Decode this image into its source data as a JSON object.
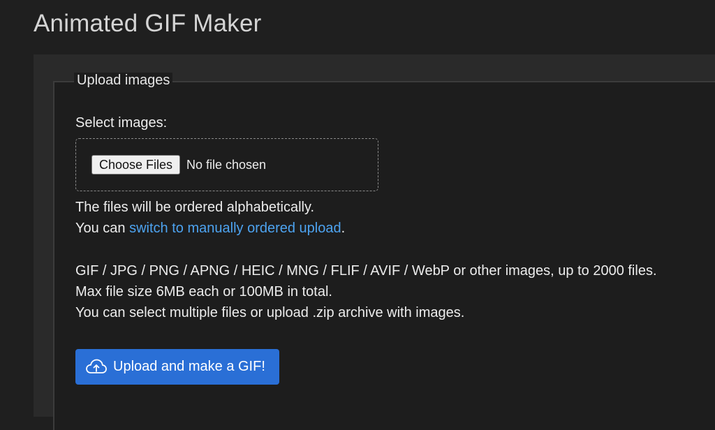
{
  "page": {
    "title": "Animated GIF Maker"
  },
  "upload": {
    "legend": "Upload images",
    "select_label": "Select images:",
    "choose_files_label": "Choose Files",
    "no_file_text": "No file chosen",
    "order_note": "The files will be ordered alphabetically.",
    "switch_prefix": "You can ",
    "switch_link": "switch to manually ordered upload",
    "switch_suffix": ".",
    "formats_line": "GIF / JPG / PNG / APNG / HEIC / MNG / FLIF / AVIF / WebP or other images, up to 2000 files.",
    "size_line": "Max file size 6MB each or 100MB in total.",
    "zip_line": "You can select multiple files or upload .zip archive with images.",
    "submit_label": "Upload and make a GIF!",
    "submit_icon": "cloud-upload-icon"
  },
  "colors": {
    "background": "#1f1f1f",
    "panel": "#2a2a2a",
    "link": "#4da3f0",
    "primary_button": "#2a6fd6"
  }
}
